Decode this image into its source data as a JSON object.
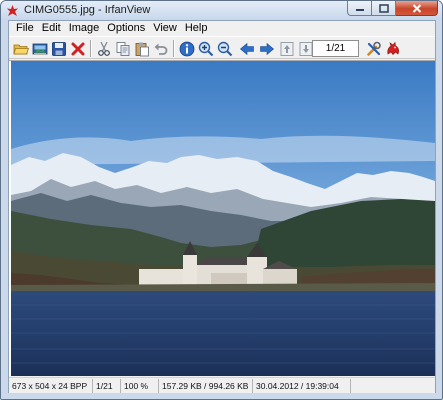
{
  "window": {
    "title": "CIMG0555.jpg - IrfanView"
  },
  "menu": [
    "File",
    "Edit",
    "Image",
    "Options",
    "View",
    "Help"
  ],
  "toolbar": {
    "buttons": [
      "open-icon",
      "slideshow-icon",
      "save-icon",
      "delete-icon",
      "cut-icon",
      "copy-icon",
      "paste-icon",
      "undo-icon",
      "info-icon",
      "zoom-in-icon",
      "zoom-out-icon",
      "previous-icon",
      "next-icon",
      "first-page-icon",
      "last-page-icon",
      "properties-icon",
      "irfanview-logo-icon"
    ],
    "page_indicator": "1/21"
  },
  "image": {
    "description_icon": "photo-lake-castle-mountains"
  },
  "status": {
    "dimensions": "673 x 504 x 24 BPP",
    "index": "1/21",
    "zoom": "100 %",
    "size": "157.29 KB / 994.26 KB",
    "datetime": "30.04.2012 / 19:39:04"
  },
  "colors": {
    "accent_blue": "#2f6ec7",
    "delete_red": "#d02020",
    "close_red": "#c8452a",
    "sky_top": "#3f7fc6",
    "water": "#243e6c"
  }
}
